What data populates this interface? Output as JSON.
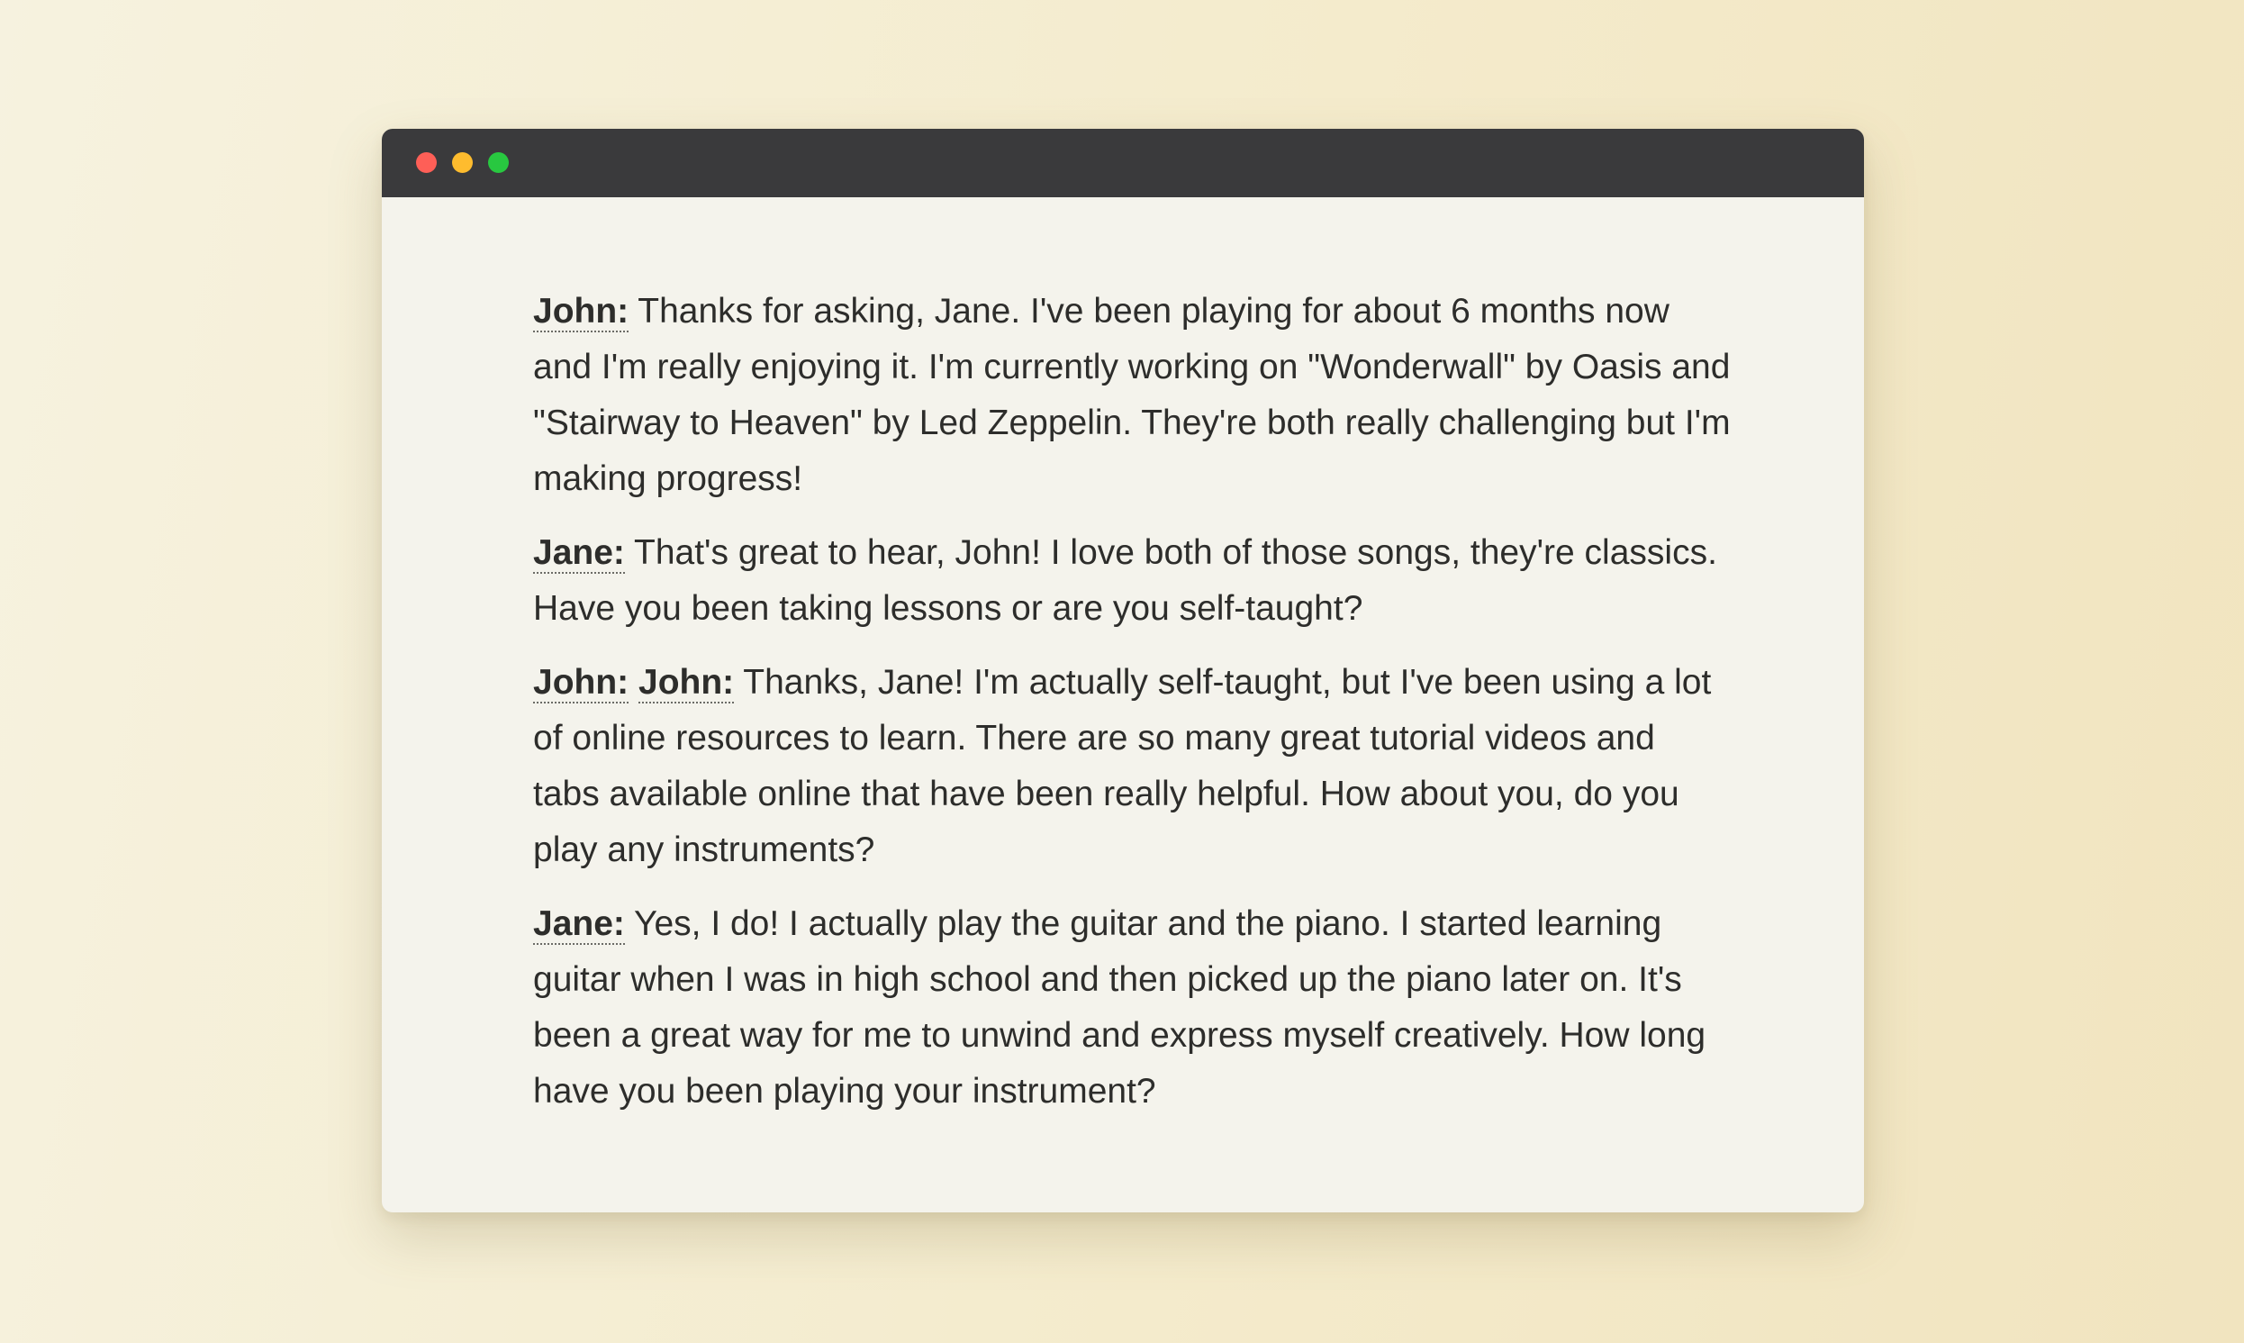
{
  "window": {
    "controls": {
      "close_color": "#fe5f57",
      "minimize_color": "#febc2e",
      "maximize_color": "#28c840"
    }
  },
  "conversation": [
    {
      "speakers": [
        "John:"
      ],
      "text": " Thanks for asking, Jane. I've been playing for about 6 months now and I'm really enjoying it. I'm currently working on \"Wonderwall\" by Oasis and \"Stairway to Heaven\" by Led Zeppelin. They're both really challenging but I'm making progress!"
    },
    {
      "speakers": [
        "Jane:"
      ],
      "text": " That's great to hear, John! I love both of those songs, they're classics. Have you been taking lessons or are you self-taught?"
    },
    {
      "speakers": [
        "John:",
        "John:"
      ],
      "text": " Thanks, Jane! I'm actually self-taught, but I've been using a lot of online resources to learn. There are so many great tutorial videos and tabs available online that have been really helpful. How about you, do you play any instruments?"
    },
    {
      "speakers": [
        "Jane:"
      ],
      "text": " Yes, I do! I actually play the guitar and the piano. I started learning guitar when I was in high school and then picked up the piano later on. It's been a great way for me to unwind and express myself creatively. How long have you been playing your instrument?"
    }
  ]
}
